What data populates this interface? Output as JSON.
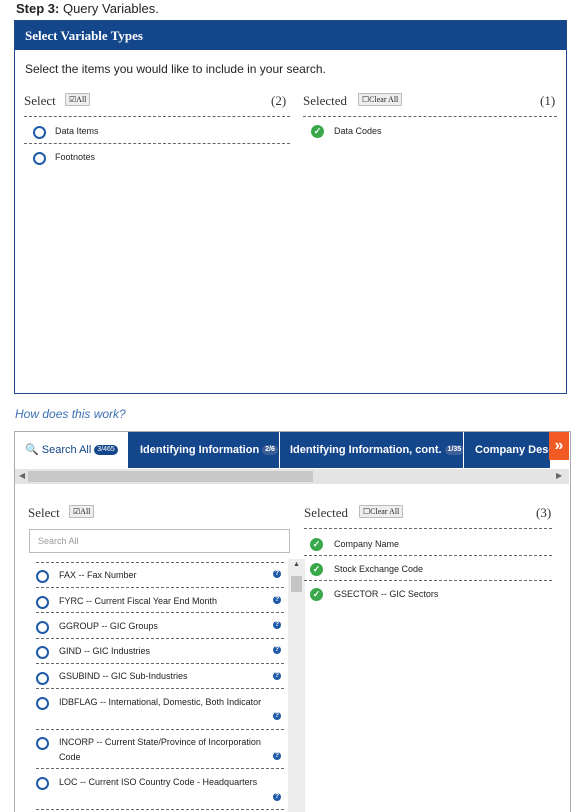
{
  "step": {
    "bold": "Step 3:",
    "text": "Query Variables."
  },
  "panel1": {
    "title": "Select Variable Types",
    "instruction": "Select the items you would like to include in your search.",
    "select_label": "Select",
    "all_label": "All",
    "select_count": "(2)",
    "selected_label": "Selected",
    "clear_label": "Clear All",
    "selected_count": "(1)",
    "available": [
      "Data Items",
      "Footnotes"
    ],
    "selected": [
      "Data Codes"
    ]
  },
  "how_link": "How does this work?",
  "tabs": [
    {
      "label": "Search All",
      "badge": "3/465"
    },
    {
      "label": "Identifying Information",
      "badge": "2/6"
    },
    {
      "label": "Identifying Information, cont.",
      "badge": "1/35"
    },
    {
      "label": "Company Desc"
    }
  ],
  "panel2": {
    "select_label": "Select",
    "all_label": "All",
    "selected_label": "Selected",
    "clear_label": "Clear All",
    "selected_count": "(3)",
    "search_placeholder": "Search All",
    "available": [
      {
        "label": "FAX -- Fax Number"
      },
      {
        "label": "FYRC -- Current Fiscal Year End Month"
      },
      {
        "label": "GGROUP -- GIC Groups"
      },
      {
        "label": "GIND -- GIC Industries"
      },
      {
        "label": "GSUBIND -- GIC Sub-Industries"
      },
      {
        "label": "IDBFLAG -- International, Domestic, Both Indicator"
      },
      {
        "label": "INCORP -- Current State/Province of Incorporation",
        "label2": "Code"
      },
      {
        "label": "LOC -- Current ISO Country Code - Headquarters"
      }
    ],
    "selected": [
      "Company Name",
      "Stock Exchange Code",
      "GSECTOR -- GIC Sectors"
    ]
  },
  "colors": {
    "brand": "#14468c",
    "accent": "#f15a22",
    "check": "#39a84a"
  }
}
